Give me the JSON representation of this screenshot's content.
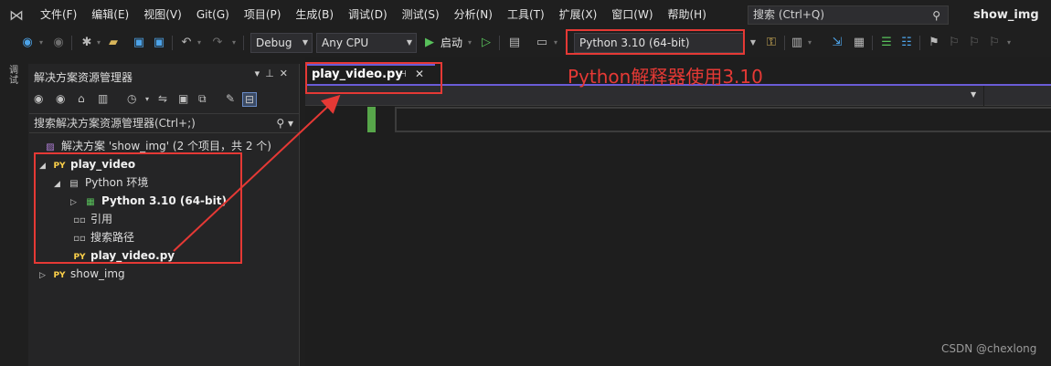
{
  "menu": {
    "items": [
      "文件(F)",
      "编辑(E)",
      "视图(V)",
      "Git(G)",
      "项目(P)",
      "生成(B)",
      "调试(D)",
      "测试(S)",
      "分析(N)",
      "工具(T)",
      "扩展(X)",
      "窗口(W)",
      "帮助(H)"
    ],
    "search_placeholder": "搜索 (Ctrl+Q)",
    "window_title": "show_img"
  },
  "toolbar": {
    "configuration": "Debug",
    "platform": "Any CPU",
    "launch_label": "启动",
    "python_env": "Python 3.10 (64-bit)"
  },
  "vertical_tab": "调试",
  "solution_explorer": {
    "title": "解决方案资源管理器",
    "search_label": "搜索解决方案资源管理器(Ctrl+;)",
    "tree": {
      "solution": "解决方案 'show_img' (2 个项目，共 2 个)",
      "project1": "play_video",
      "python_env_node": "Python 环境",
      "python_version": "Python 3.10 (64-bit)",
      "references": "引用",
      "search_paths": "搜索路径",
      "file": "play_video.py",
      "project2": "show_img"
    }
  },
  "editor": {
    "tab_name": "play_video.py"
  },
  "annotation_text": "Python解释器使用3.10",
  "watermark": "CSDN @chexlong",
  "colors": {
    "highlight": "#e53935",
    "accent": "#6a5cd7",
    "gutter_change": "#57a64a"
  }
}
